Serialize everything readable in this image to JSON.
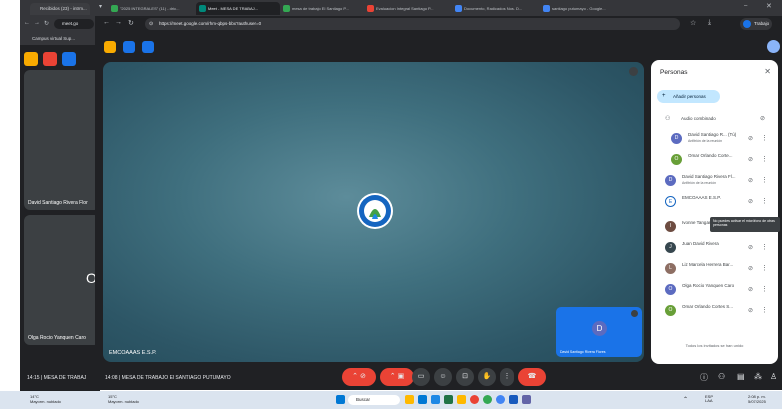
{
  "back_window": {
    "tab_title": "Recibidos (23) - intrm...",
    "url": "meet.go",
    "bookmark": "Campus virtual Sup...",
    "tiles": [
      {
        "name": "David Santiago Rivera Flor"
      },
      {
        "name": "Olga Rocio Yanquen Caro",
        "initial": "O"
      }
    ]
  },
  "tabs": [
    {
      "label": "\"2025 INTEGRALES\" (11) - dric...",
      "active": false,
      "color": "#34a853"
    },
    {
      "label": "Meet - MESA DE TRABAJ...",
      "active": true,
      "color": "#00897b"
    },
    {
      "label": "mesa de trabajo El Santiago P...",
      "active": false,
      "color": "#34a853"
    },
    {
      "label": "Evaluacion Integral Santiago P...",
      "active": false,
      "color": "#ea4335"
    },
    {
      "label": "Documento, Radicados Nos. D...",
      "active": false,
      "color": "#4285f4"
    },
    {
      "label": "santiago putumayo - Google...",
      "active": false,
      "color": "#4285f4"
    }
  ],
  "omnibox": {
    "url": "https://meet.google.com/rhm-qbps-bbx?authuser=0",
    "profile": "Trabajo"
  },
  "meeting": {
    "main_tile_name": "EMCOAAAS E.S.P.",
    "self_view_initial": "D",
    "self_view_name": "David Santiago Rivera Flores",
    "time": "14:15",
    "title": "MESA DE TRABAJ",
    "time2": "14:08",
    "title2": "MESA DE TRABAJO El SANTIAGO PUTUMAYO"
  },
  "people_panel": {
    "title": "Personas",
    "add_button": "Añadir personas",
    "group_label": "Audio combinado",
    "participants": [
      {
        "name": "David Santiago R... (Tú)",
        "sub": "Anfitrión de la reunión",
        "initial": "D",
        "color": "#5c6bc0",
        "indent": true
      },
      {
        "name": "Omar Orlando Corte...",
        "sub": "",
        "initial": "O",
        "color": "#689f38",
        "indent": true
      },
      {
        "name": "David Santiago Rivera Fl...",
        "sub": "Anfitrión de la reunión",
        "initial": "D",
        "color": "#5c6bc0",
        "indent": false
      },
      {
        "name": "EMCOAAAS E.S.P.",
        "sub": "",
        "initial": "E",
        "color": "#ffffff",
        "indent": false
      },
      {
        "name": "Ivonne Tangari...",
        "sub": "",
        "initial": "I",
        "color": "#6d4c41",
        "indent": false
      },
      {
        "name": "Juan David Rivera",
        "sub": "",
        "initial": "J",
        "color": "#37474f",
        "indent": false
      },
      {
        "name": "Liz Marcela Herrera Bar...",
        "sub": "",
        "initial": "L",
        "color": "#8d6e63",
        "indent": false
      },
      {
        "name": "Olga Rocio Yanquen Caro",
        "sub": "",
        "initial": "O",
        "color": "#5c6bc0",
        "indent": false
      },
      {
        "name": "Omar Orlando Cortes S...",
        "sub": "",
        "initial": "O",
        "color": "#689f38",
        "indent": false
      }
    ],
    "tooltip": "No puedes activar el micrófono de otras personas",
    "footer": "Todos los invitados se han unido"
  },
  "taskbar": {
    "weather_left": {
      "temp": "14°C",
      "desc": "Mayorm. nublado"
    },
    "weather_right": {
      "temp": "15°C",
      "desc": "Mayorm. nublado"
    },
    "search": "Buscar",
    "lang": "ESP LAA",
    "clock_time": "2:08 p. m.",
    "clock_date": "5/07/2025"
  }
}
